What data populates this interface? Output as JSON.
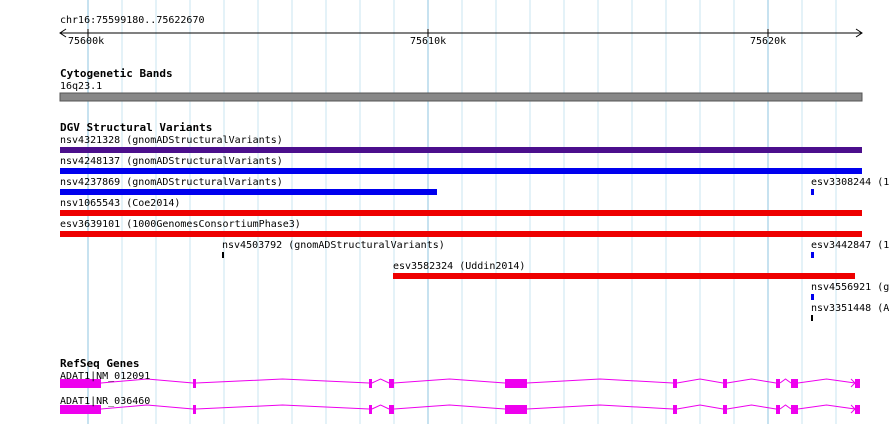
{
  "ruler": {
    "coords": "chr16:75599180..75622670",
    "ticks": [
      "75600k",
      "75610k",
      "75620k"
    ]
  },
  "cytoband": {
    "title": "Cytogenetic Bands",
    "band": "16q23.1",
    "color": "#888888"
  },
  "dgv": {
    "title": "DGV Structural Variants",
    "features": [
      {
        "label": "nsv4321328 (gnomADStructuralVariants)",
        "color": "#4b0f8c"
      },
      {
        "label": "nsv4248137 (gnomADStructuralVariants)",
        "color": "#0000ee"
      },
      {
        "label": "nsv4237869 (gnomADStructuralVariants)",
        "color": "#0000ee"
      },
      {
        "label": "esv3308244 (1(",
        "color": "#0000ee"
      },
      {
        "label": "nsv1065543 (Coe2014)",
        "color": "#ee0000"
      },
      {
        "label": "esv3639101 (1000GenomesConsortiumPhase3)",
        "color": "#ee0000"
      },
      {
        "label": "nsv4503792 (gnomADStructuralVariants)",
        "color": "#000000"
      },
      {
        "label": "esv3442847 (1",
        "color": "#0000ee"
      },
      {
        "label": "esv3582324 (Uddin2014)",
        "color": "#ee0000"
      },
      {
        "label": "nsv4556921 (g",
        "color": "#0000ee"
      },
      {
        "label": "nsv3351448 (A",
        "color": "#000000"
      }
    ]
  },
  "refseq": {
    "title": "RefSeq Genes",
    "color": "#ee00ee",
    "transcripts": [
      {
        "label": "ADAT1|NM_012091"
      },
      {
        "label": "ADAT1|NR_036460"
      }
    ]
  }
}
